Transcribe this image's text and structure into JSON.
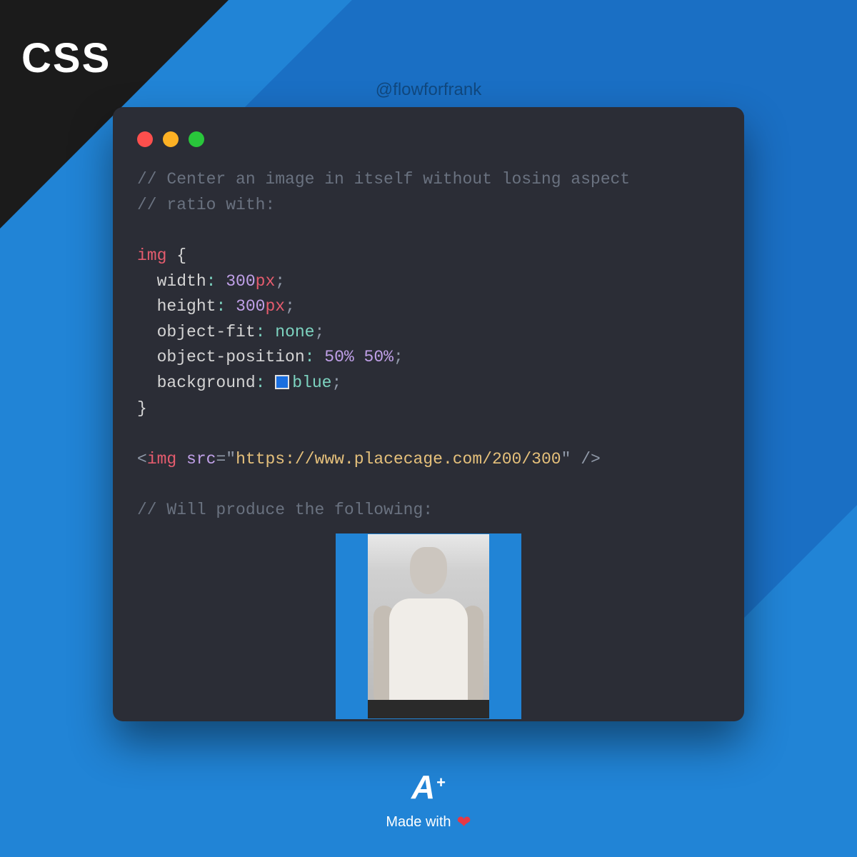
{
  "header": {
    "label": "CSS",
    "handle": "@flowforfrank"
  },
  "code": {
    "comment1": "// Center an image in itself without losing aspect",
    "comment2": "// ratio with:",
    "selector": "img",
    "props": {
      "width_name": "width",
      "width_value": "300",
      "width_unit": "px",
      "height_name": "height",
      "height_value": "300",
      "height_unit": "px",
      "fit_name": "object-fit",
      "fit_value": "none",
      "pos_name": "object-position",
      "pos_v1": "50%",
      "pos_v2": "50%",
      "bg_name": "background",
      "bg_value": "blue"
    },
    "html_tag": "img",
    "html_attr": "src",
    "html_url": "https://www.placecage.com/200/300",
    "comment3": "// Will produce the following:"
  },
  "footer": {
    "logo_letter": "A",
    "logo_plus": "+",
    "made_with": "Made with"
  }
}
